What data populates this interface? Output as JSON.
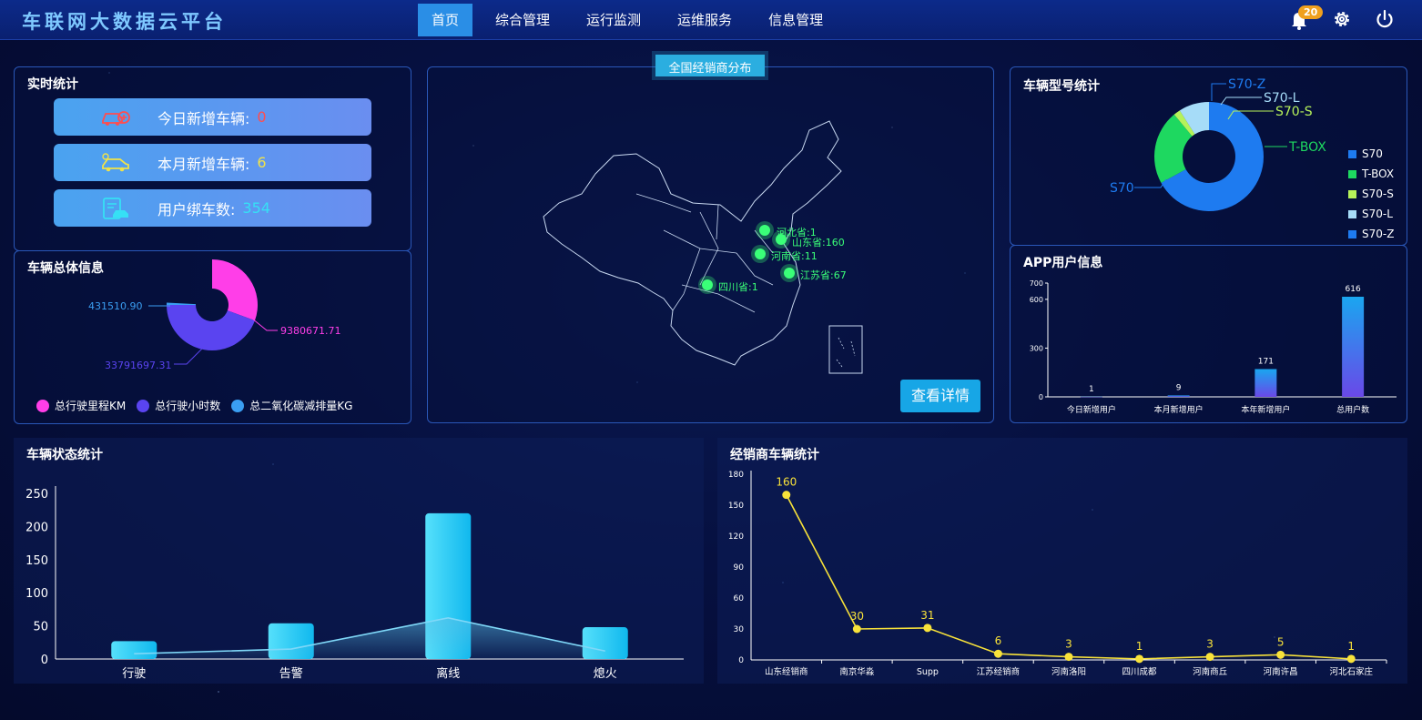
{
  "header": {
    "title": "车联网大数据云平台",
    "nav": [
      "首页",
      "综合管理",
      "运行监测",
      "运维服务",
      "信息管理"
    ],
    "active_nav": "首页",
    "notification_count": "20"
  },
  "realtime": {
    "title": "实时统计",
    "items": [
      {
        "label": "今日新增车辆:",
        "value": "0",
        "color": "#ff4d4f",
        "icon": "car-add-icon"
      },
      {
        "label": "本月新增车辆:",
        "value": "6",
        "color": "#f0e24a",
        "icon": "car-icon"
      },
      {
        "label": "用户绑车数:",
        "value": "354",
        "color": "#36e0f5",
        "icon": "car-clipboard-icon"
      }
    ]
  },
  "overall": {
    "title": "车辆总体信息",
    "labels": [
      "431510.90",
      "9380671.71",
      "33791697.31"
    ],
    "legend": [
      "总行驶里程KM",
      "总行驶小时数",
      "总二氧化碳减排量KG"
    ],
    "colors": [
      "#ff3ee8",
      "#5a44f0",
      "#3a9ef2"
    ]
  },
  "map": {
    "button": "全国经销商分布",
    "detail_button": "查看详情",
    "points": [
      "河北省:1",
      "山东省:160",
      "河南省:11",
      "江苏省:67",
      "四川省:1"
    ]
  },
  "model": {
    "title": "车辆型号统计",
    "legend": [
      "S70",
      "T-BOX",
      "S70-S",
      "S70-L",
      "S70-Z"
    ],
    "legend_colors": [
      "#1e7bf0",
      "#1ed860",
      "#b6f25a",
      "#a6dcf8",
      "#1e7bf0"
    ]
  },
  "app": {
    "title": "APP用户信息"
  },
  "status": {
    "title": "车辆状态统计"
  },
  "dealer": {
    "title": "经销商车辆统计"
  },
  "chart_data": [
    {
      "type": "pie",
      "title": "车辆总体信息",
      "labels": [
        "总行驶里程KM",
        "总行驶小时数",
        "总二氧化碳减排量KG"
      ],
      "values": [
        431510.9,
        9380671.71,
        33791697.31
      ]
    },
    {
      "type": "pie",
      "title": "车辆型号统计",
      "labels": [
        "S70",
        "T-BOX",
        "S70-S",
        "S70-L",
        "S70-Z"
      ],
      "values": [
        67,
        22,
        2,
        9,
        0
      ]
    },
    {
      "type": "bar",
      "title": "APP用户信息",
      "categories": [
        "今日新增用户",
        "本月新增用户",
        "本年新增用户",
        "总用户数"
      ],
      "values": [
        1,
        9,
        171,
        616
      ],
      "ylim": [
        0,
        700
      ],
      "yticks": [
        "0",
        "300",
        "600",
        "700"
      ]
    },
    {
      "type": "bar",
      "title": "车辆状态统计",
      "categories": [
        "行驶",
        "告警",
        "离线",
        "熄火"
      ],
      "values": [
        27,
        54,
        220,
        48
      ],
      "line_values": [
        8,
        15,
        62,
        12
      ],
      "ylim": [
        0,
        250
      ],
      "yticks": [
        "0",
        "50",
        "100",
        "150",
        "200",
        "250"
      ]
    },
    {
      "type": "line",
      "title": "经销商车辆统计",
      "categories": [
        "山东经销商",
        "南京华淼",
        "Supp",
        "江苏经销商",
        "河南洛阳",
        "四川成都",
        "河南商丘",
        "河南许昌",
        "河北石家庄"
      ],
      "values": [
        160,
        30,
        31,
        6,
        3,
        1,
        3,
        5,
        1
      ],
      "ylim": [
        0,
        180
      ],
      "yticks": [
        "0",
        "30",
        "60",
        "90",
        "120",
        "150",
        "180"
      ]
    }
  ]
}
